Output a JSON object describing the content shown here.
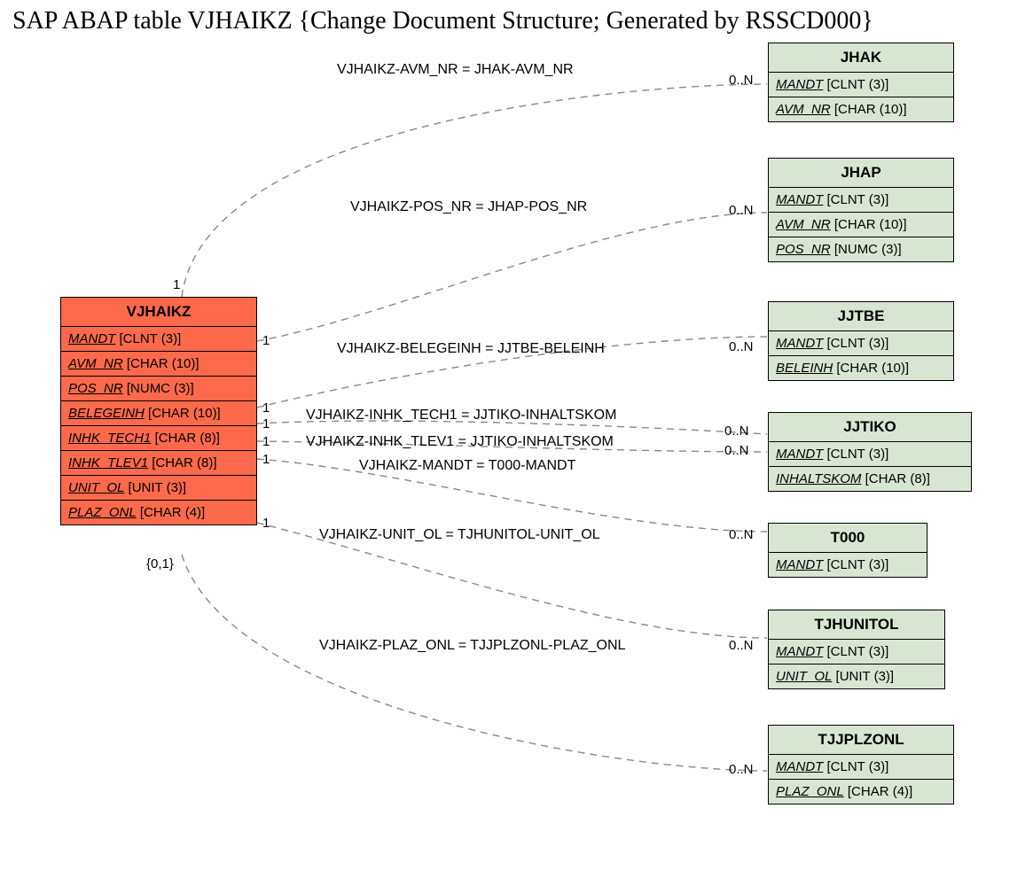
{
  "title": "SAP ABAP table VJHAIKZ {Change Document Structure; Generated by RSSCD000}",
  "main_entity": {
    "name": "VJHAIKZ",
    "fields": [
      {
        "name": "MANDT",
        "type": "[CLNT (3)]"
      },
      {
        "name": "AVM_NR",
        "type": "[CHAR (10)]"
      },
      {
        "name": "POS_NR",
        "type": "[NUMC (3)]"
      },
      {
        "name": "BELEGEINH",
        "type": "[CHAR (10)]"
      },
      {
        "name": "INHK_TECH1",
        "type": "[CHAR (8)]"
      },
      {
        "name": "INHK_TLEV1",
        "type": "[CHAR (8)]"
      },
      {
        "name": "UNIT_OL",
        "type": "[UNIT (3)]"
      },
      {
        "name": "PLAZ_ONL",
        "type": "[CHAR (4)]"
      }
    ]
  },
  "related": [
    {
      "name": "JHAK",
      "fields": [
        {
          "name": "MANDT",
          "type": "[CLNT (3)]"
        },
        {
          "name": "AVM_NR",
          "type": "[CHAR (10)]"
        }
      ]
    },
    {
      "name": "JHAP",
      "fields": [
        {
          "name": "MANDT",
          "type": "[CLNT (3)]"
        },
        {
          "name": "AVM_NR",
          "type": "[CHAR (10)]"
        },
        {
          "name": "POS_NR",
          "type": "[NUMC (3)]"
        }
      ]
    },
    {
      "name": "JJTBE",
      "fields": [
        {
          "name": "MANDT",
          "type": "[CLNT (3)]"
        },
        {
          "name": "BELEINH",
          "type": "[CHAR (10)]"
        }
      ]
    },
    {
      "name": "JJTIKO",
      "fields": [
        {
          "name": "MANDT",
          "type": "[CLNT (3)]"
        },
        {
          "name": "INHALTSKOM",
          "type": "[CHAR (8)]"
        }
      ]
    },
    {
      "name": "T000",
      "fields": [
        {
          "name": "MANDT",
          "type": "[CLNT (3)]"
        }
      ]
    },
    {
      "name": "TJHUNITOL",
      "fields": [
        {
          "name": "MANDT",
          "type": "[CLNT (3)]"
        },
        {
          "name": "UNIT_OL",
          "type": "[UNIT (3)]"
        }
      ]
    },
    {
      "name": "TJJPLZONL",
      "fields": [
        {
          "name": "MANDT",
          "type": "[CLNT (3)]"
        },
        {
          "name": "PLAZ_ONL",
          "type": "[CHAR (4)]"
        }
      ]
    }
  ],
  "links": [
    {
      "label": "VJHAIKZ-AVM_NR = JHAK-AVM_NR",
      "card_l": "1",
      "card_r": "0..N"
    },
    {
      "label": "VJHAIKZ-POS_NR = JHAP-POS_NR",
      "card_l": "1",
      "card_r": "0..N"
    },
    {
      "label": "VJHAIKZ-BELEGEINH = JJTBE-BELEINH",
      "card_l": "1",
      "card_r": "0..N"
    },
    {
      "label": "VJHAIKZ-INHK_TECH1 = JJTIKO-INHALTSKOM",
      "card_l": "1",
      "card_r": "0..N"
    },
    {
      "label": "VJHAIKZ-INHK_TLEV1 = JJTIKO-INHALTSKOM",
      "card_l": "1",
      "card_r": "0..N"
    },
    {
      "label": "VJHAIKZ-MANDT = T000-MANDT",
      "card_l": "1",
      "card_r": ""
    },
    {
      "label": "VJHAIKZ-UNIT_OL = TJHUNITOL-UNIT_OL",
      "card_l": "1",
      "card_r": "0..N"
    },
    {
      "label": "VJHAIKZ-PLAZ_ONL = TJJPLZONL-PLAZ_ONL",
      "card_l": "{0,1}",
      "card_r": "0..N"
    }
  ]
}
